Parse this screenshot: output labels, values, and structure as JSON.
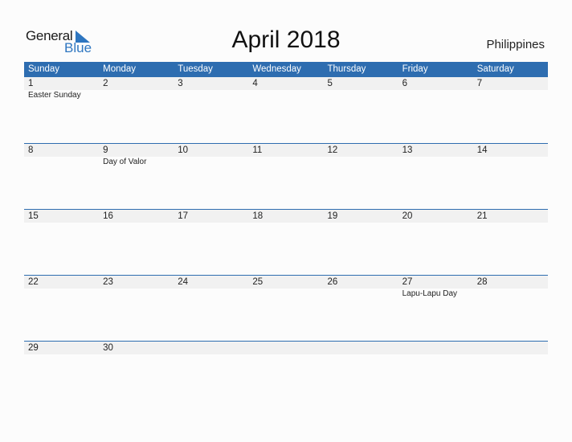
{
  "logo": {
    "word1": "General",
    "word2": "Blue"
  },
  "title": "April 2018",
  "country": "Philippines",
  "colors": {
    "header": "#2e6db0",
    "band": "#f1f1f1",
    "logo_blue": "#2e76c0"
  },
  "weekdays": [
    "Sunday",
    "Monday",
    "Tuesday",
    "Wednesday",
    "Thursday",
    "Friday",
    "Saturday"
  ],
  "weeks": [
    [
      {
        "day": "1",
        "event": "Easter Sunday"
      },
      {
        "day": "2",
        "event": ""
      },
      {
        "day": "3",
        "event": ""
      },
      {
        "day": "4",
        "event": ""
      },
      {
        "day": "5",
        "event": ""
      },
      {
        "day": "6",
        "event": ""
      },
      {
        "day": "7",
        "event": ""
      }
    ],
    [
      {
        "day": "8",
        "event": ""
      },
      {
        "day": "9",
        "event": "Day of Valor"
      },
      {
        "day": "10",
        "event": ""
      },
      {
        "day": "11",
        "event": ""
      },
      {
        "day": "12",
        "event": ""
      },
      {
        "day": "13",
        "event": ""
      },
      {
        "day": "14",
        "event": ""
      }
    ],
    [
      {
        "day": "15",
        "event": ""
      },
      {
        "day": "16",
        "event": ""
      },
      {
        "day": "17",
        "event": ""
      },
      {
        "day": "18",
        "event": ""
      },
      {
        "day": "19",
        "event": ""
      },
      {
        "day": "20",
        "event": ""
      },
      {
        "day": "21",
        "event": ""
      }
    ],
    [
      {
        "day": "22",
        "event": ""
      },
      {
        "day": "23",
        "event": ""
      },
      {
        "day": "24",
        "event": ""
      },
      {
        "day": "25",
        "event": ""
      },
      {
        "day": "26",
        "event": ""
      },
      {
        "day": "27",
        "event": "Lapu-Lapu Day"
      },
      {
        "day": "28",
        "event": ""
      }
    ],
    [
      {
        "day": "29",
        "event": ""
      },
      {
        "day": "30",
        "event": ""
      },
      {
        "day": "",
        "event": ""
      },
      {
        "day": "",
        "event": ""
      },
      {
        "day": "",
        "event": ""
      },
      {
        "day": "",
        "event": ""
      },
      {
        "day": "",
        "event": ""
      }
    ]
  ]
}
